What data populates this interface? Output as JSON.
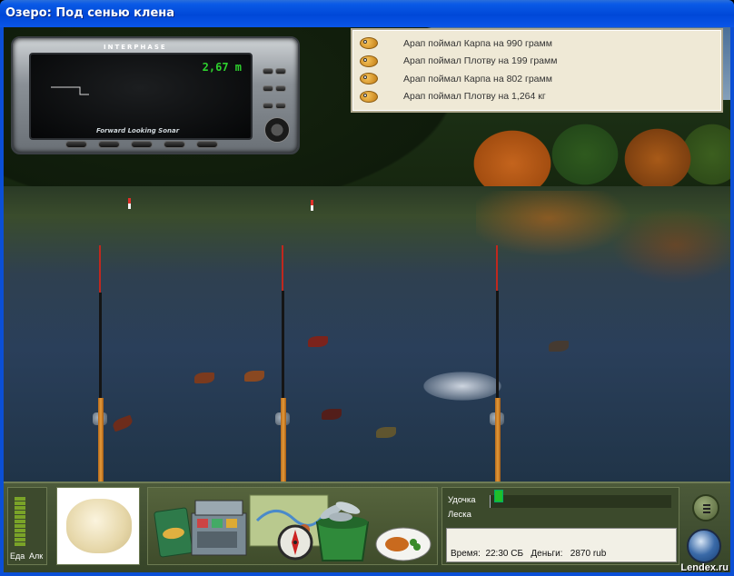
{
  "window": {
    "title": "Озеро: Под сенью клена"
  },
  "sonar": {
    "brand": "INTERPHASE",
    "depth": "2,67 m",
    "caption": "Forward Looking Sonar",
    "icon": "sonar-device-icon"
  },
  "catch_log": [
    {
      "text": "Арап поймал Карпа на 990 грамм",
      "icon": "fish-icon"
    },
    {
      "text": "Арап поймал Плотву на 199 грамм",
      "icon": "fish-icon"
    },
    {
      "text": "Арап поймал Карпа на 802 грамм",
      "icon": "fish-icon"
    },
    {
      "text": "Арап поймал Плотву на 1,264 кг",
      "icon": "fish-icon"
    }
  ],
  "panel": {
    "meters": {
      "food_label": "Еда",
      "alcohol_label": "Алк",
      "food_level": 1.0,
      "alcohol_level": 0
    },
    "bait_icon": "dough-bait-icon",
    "tray_icons": [
      "fish-guide-book-icon",
      "tackle-box-icon",
      "map-icon",
      "compass-icon",
      "fish-bucket-icon",
      "fish-plate-icon"
    ],
    "status": {
      "rod_label": "Удочка",
      "line_label": "Леска",
      "rod_tension": 0.05,
      "time_label": "Время:",
      "time_value": "22:30 СБ",
      "money_label": "Деньги:",
      "money_value": "2870 rub"
    },
    "menu_icon": "menu-icon",
    "globe_icon": "globe-icon"
  },
  "watermark": "Lendex.ru",
  "colors": {
    "titlebar": "#0048d8",
    "sonar_digits": "#2ed12e",
    "meter_green": "#7aa328",
    "gauge_fill": "#1fbf2a",
    "rod_tip": "#c0281e"
  }
}
